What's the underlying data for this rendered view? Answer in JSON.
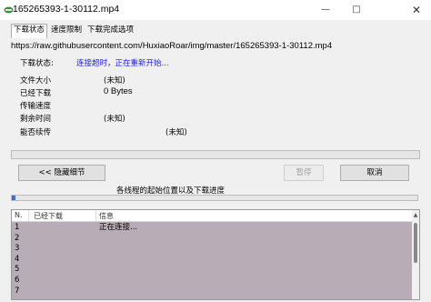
{
  "window": {
    "title": "165265393-1-30112.mp4"
  },
  "tabs": [
    {
      "label": "下载状态",
      "active": true
    },
    {
      "label": "速度限制",
      "active": false
    },
    {
      "label": "下载完成选项",
      "active": false
    }
  ],
  "status": {
    "url": "https://raw.githubusercontent.com/HuxiaoRoar/img/master/165265393-1-30112.mp4",
    "state_label": "下载状态:",
    "state_value": "连接超时，正在重新开始...",
    "file_size_label": "文件大小",
    "file_size_value": "(未知)",
    "downloaded_label": "已经下载",
    "downloaded_value": "0 Bytes",
    "speed_label": "传输速度",
    "speed_value": "",
    "remaining_label": "剩余时间",
    "remaining_value": "(未知)",
    "resume_label": "能否续传",
    "resume_value": "(未知)"
  },
  "progress": {
    "overall": 0
  },
  "buttons": {
    "hide_details": "<< 隐藏细节",
    "pause": "暂停",
    "cancel": "取消"
  },
  "thread_caption": "各线程的起始位置以及下载进度",
  "thread_progress": 0.01,
  "list": {
    "columns": [
      "N.",
      "已经下载",
      "信息"
    ],
    "rows": [
      {
        "n": "1",
        "downloaded": "",
        "info": "正在连接..."
      },
      {
        "n": "2",
        "downloaded": "",
        "info": ""
      },
      {
        "n": "3",
        "downloaded": "",
        "info": ""
      },
      {
        "n": "4",
        "downloaded": "",
        "info": ""
      },
      {
        "n": "5",
        "downloaded": "",
        "info": ""
      },
      {
        "n": "6",
        "downloaded": "",
        "info": ""
      },
      {
        "n": "7",
        "downloaded": "",
        "info": ""
      }
    ]
  },
  "colors": {
    "status_text": "#1a1ae0",
    "list_background": "#b8adb6",
    "thread_fill": "#3a6fd8"
  }
}
